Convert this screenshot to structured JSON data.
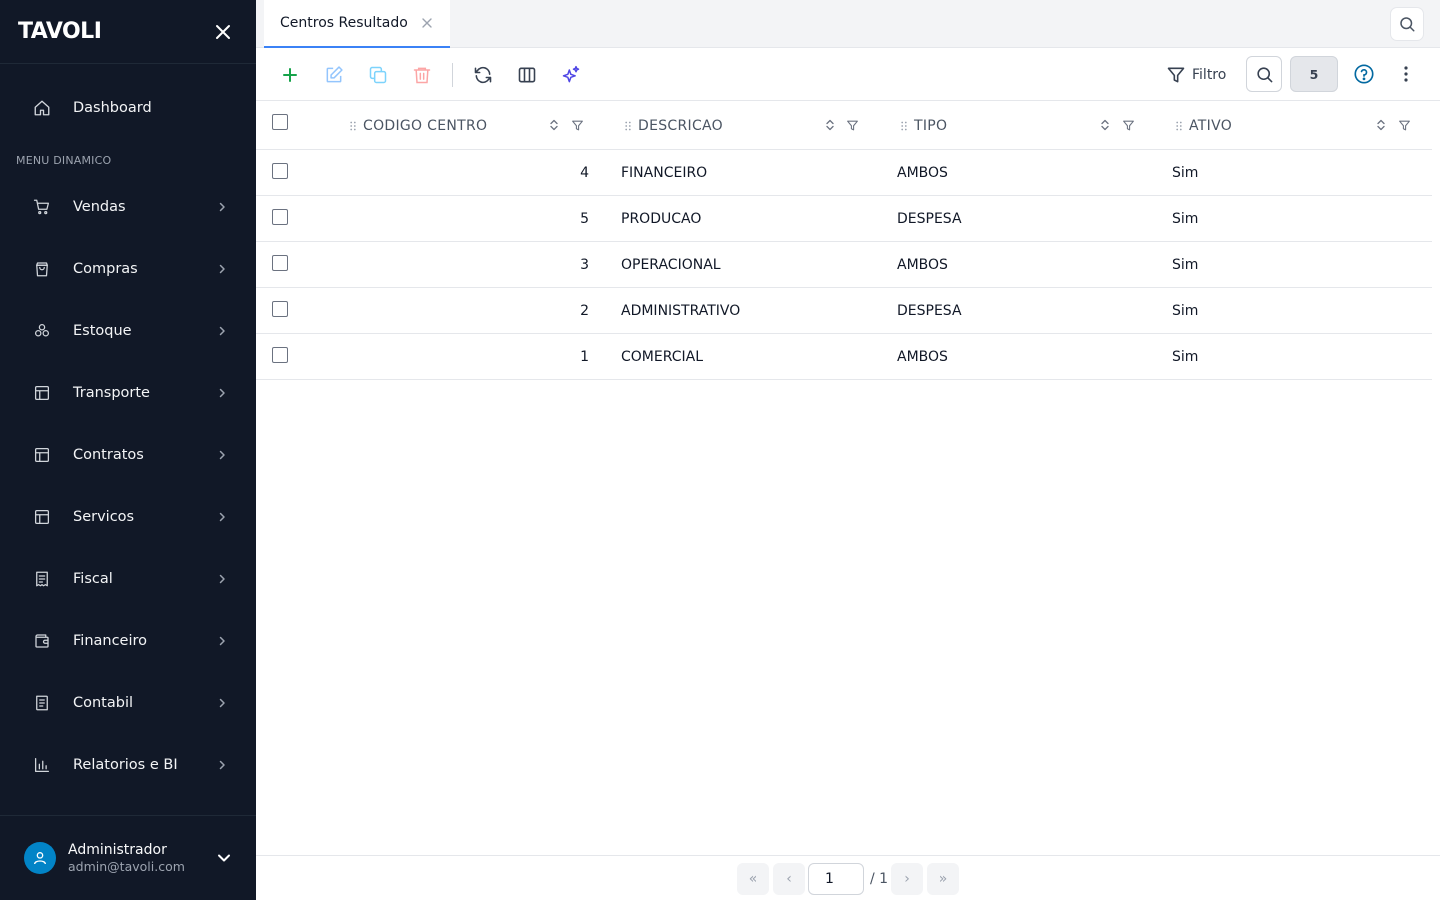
{
  "sidebar": {
    "logo": "TAVOLI",
    "dashboard": {
      "label": "Dashboard",
      "icon": "home-icon"
    },
    "section_label": "MENU DINAMICO",
    "items": [
      {
        "label": "Vendas",
        "icon": "cart-icon"
      },
      {
        "label": "Compras",
        "icon": "bag-icon"
      },
      {
        "label": "Estoque",
        "icon": "boxes-icon"
      },
      {
        "label": "Transporte",
        "icon": "layout-icon"
      },
      {
        "label": "Contratos",
        "icon": "layout-icon"
      },
      {
        "label": "Servicos",
        "icon": "layout-icon"
      },
      {
        "label": "Fiscal",
        "icon": "receipt-icon"
      },
      {
        "label": "Financeiro",
        "icon": "wallet-icon"
      },
      {
        "label": "Contabil",
        "icon": "book-icon"
      },
      {
        "label": "Relatorios e BI",
        "icon": "bar-chart-icon"
      }
    ],
    "user": {
      "name": "Administrador",
      "email": "admin@tavoli.com"
    }
  },
  "tabs": [
    {
      "label": "Centros Resultado",
      "active": true
    }
  ],
  "toolbar": {
    "filter_label": "Filtro",
    "record_count": "5"
  },
  "table": {
    "columns": [
      "CODIGO CENTRO",
      "DESCRICAO",
      "TIPO",
      "ATIVO"
    ],
    "rows": [
      {
        "codigo": "4",
        "descricao": "FINANCEIRO",
        "tipo": "AMBOS",
        "ativo": "Sim"
      },
      {
        "codigo": "5",
        "descricao": "PRODUCAO",
        "tipo": "DESPESA",
        "ativo": "Sim"
      },
      {
        "codigo": "3",
        "descricao": "OPERACIONAL",
        "tipo": "AMBOS",
        "ativo": "Sim"
      },
      {
        "codigo": "2",
        "descricao": "ADMINISTRATIVO",
        "tipo": "DESPESA",
        "ativo": "Sim"
      },
      {
        "codigo": "1",
        "descricao": "COMERCIAL",
        "tipo": "AMBOS",
        "ativo": "Sim"
      }
    ]
  },
  "pagination": {
    "current_page": "1",
    "total": "/ 1",
    "first": "«",
    "prev": "‹",
    "next": "›",
    "last": "»"
  },
  "colors": {
    "sidebar_bg": "#111827",
    "accent": "#3b82f6",
    "add": "#16a34a",
    "delete": "#ef4444",
    "ai": "#4f46e5",
    "avatar": "#0284c7"
  }
}
